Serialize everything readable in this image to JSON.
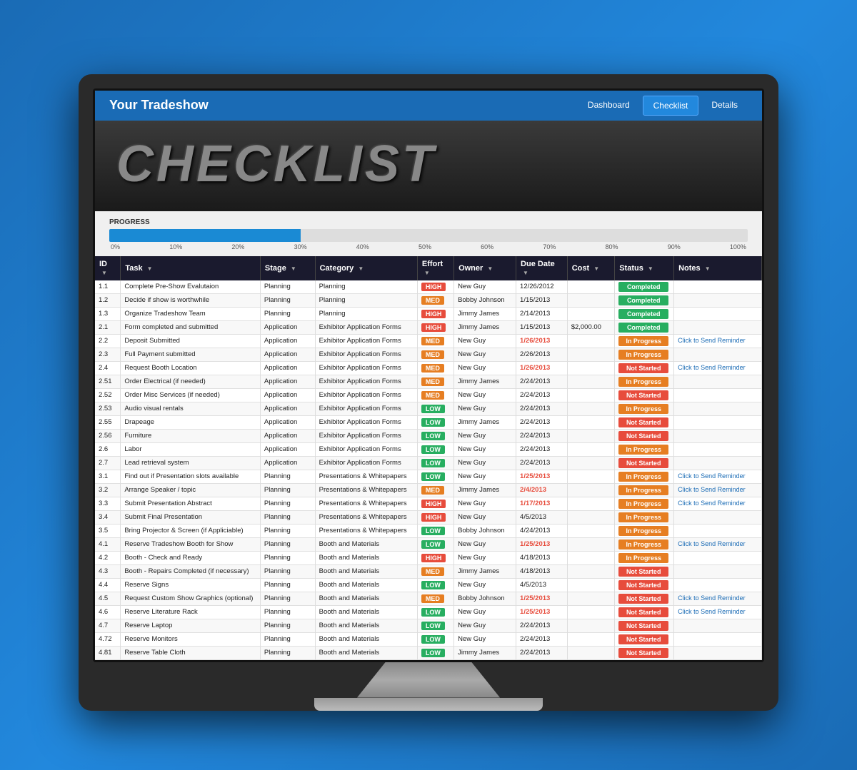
{
  "app": {
    "brand": "Your Tradeshow",
    "nav_links": [
      {
        "label": "Dashboard",
        "active": false
      },
      {
        "label": "Checklist",
        "active": true
      },
      {
        "label": "Details",
        "active": false
      }
    ]
  },
  "header": {
    "title": "CHECKLIST"
  },
  "progress": {
    "label": "PROGRESS",
    "percent": 30,
    "markers": [
      "0%",
      "10%",
      "20%",
      "30%",
      "40%",
      "50%",
      "60%",
      "70%",
      "80%",
      "90%",
      "100%"
    ]
  },
  "table": {
    "columns": [
      "ID",
      "Task",
      "Stage",
      "Category",
      "Effort",
      "Owner",
      "Due Date",
      "Cost",
      "Status",
      "Notes"
    ],
    "rows": [
      {
        "id": "1.1",
        "task": "Complete Pre-Show Evalutaion",
        "stage": "Planning",
        "category": "Planning",
        "effort": "HIGH",
        "owner": "New Guy",
        "date": "12/26/2012",
        "cost": "",
        "status": "Completed",
        "note": "",
        "date_red": false
      },
      {
        "id": "1.2",
        "task": "Decide if show is worthwhile",
        "stage": "Planning",
        "category": "Planning",
        "effort": "MED",
        "owner": "Bobby Johnson",
        "date": "1/15/2013",
        "cost": "",
        "status": "Completed",
        "note": "",
        "date_red": false
      },
      {
        "id": "1.3",
        "task": "Organize Tradeshow Team",
        "stage": "Planning",
        "category": "Planning",
        "effort": "HIGH",
        "owner": "Jimmy James",
        "date": "2/14/2013",
        "cost": "",
        "status": "Completed",
        "note": "",
        "date_red": false
      },
      {
        "id": "2.1",
        "task": "Form completed and submitted",
        "stage": "Application",
        "category": "Exhibitor Application Forms",
        "effort": "HIGH",
        "owner": "Jimmy James",
        "date": "1/15/2013",
        "cost": "$2,000.00",
        "status": "Completed",
        "note": "",
        "date_red": false
      },
      {
        "id": "2.2",
        "task": "Deposit Submitted",
        "stage": "Application",
        "category": "Exhibitor Application Forms",
        "effort": "MED",
        "owner": "New Guy",
        "date": "1/26/2013",
        "cost": "",
        "status": "In Progress",
        "note": "Click to Send Reminder",
        "date_red": true
      },
      {
        "id": "2.3",
        "task": "Full Payment submitted",
        "stage": "Application",
        "category": "Exhibitor Application Forms",
        "effort": "MED",
        "owner": "New Guy",
        "date": "2/26/2013",
        "cost": "",
        "status": "In Progress",
        "note": "",
        "date_red": false
      },
      {
        "id": "2.4",
        "task": "Request Booth Location",
        "stage": "Application",
        "category": "Exhibitor Application Forms",
        "effort": "MED",
        "owner": "New Guy",
        "date": "1/26/2013",
        "cost": "",
        "status": "Not Started",
        "note": "Click to Send Reminder",
        "date_red": true
      },
      {
        "id": "2.51",
        "task": "Order Electrical (if needed)",
        "stage": "Application",
        "category": "Exhibitor Application Forms",
        "effort": "MED",
        "owner": "Jimmy James",
        "date": "2/24/2013",
        "cost": "",
        "status": "In Progress",
        "note": "",
        "date_red": false
      },
      {
        "id": "2.52",
        "task": "Order Misc Services (if needed)",
        "stage": "Application",
        "category": "Exhibitor Application Forms",
        "effort": "MED",
        "owner": "New Guy",
        "date": "2/24/2013",
        "cost": "",
        "status": "Not Started",
        "note": "",
        "date_red": false
      },
      {
        "id": "2.53",
        "task": "Audio visual rentals",
        "stage": "Application",
        "category": "Exhibitor Application Forms",
        "effort": "LOW",
        "owner": "New Guy",
        "date": "2/24/2013",
        "cost": "",
        "status": "In Progress",
        "note": "",
        "date_red": false
      },
      {
        "id": "2.55",
        "task": "Drapeage",
        "stage": "Application",
        "category": "Exhibitor Application Forms",
        "effort": "LOW",
        "owner": "Jimmy James",
        "date": "2/24/2013",
        "cost": "",
        "status": "Not Started",
        "note": "",
        "date_red": false
      },
      {
        "id": "2.56",
        "task": "Furniture",
        "stage": "Application",
        "category": "Exhibitor Application Forms",
        "effort": "LOW",
        "owner": "New Guy",
        "date": "2/24/2013",
        "cost": "",
        "status": "Not Started",
        "note": "",
        "date_red": false
      },
      {
        "id": "2.6",
        "task": "Labor",
        "stage": "Application",
        "category": "Exhibitor Application Forms",
        "effort": "LOW",
        "owner": "New Guy",
        "date": "2/24/2013",
        "cost": "",
        "status": "In Progress",
        "note": "",
        "date_red": false
      },
      {
        "id": "2.7",
        "task": "Lead retrieval system",
        "stage": "Application",
        "category": "Exhibitor Application Forms",
        "effort": "LOW",
        "owner": "New Guy",
        "date": "2/24/2013",
        "cost": "",
        "status": "Not Started",
        "note": "",
        "date_red": false
      },
      {
        "id": "3.1",
        "task": "Find out if Presentation slots available",
        "stage": "Planning",
        "category": "Presentations & Whitepapers",
        "effort": "LOW",
        "owner": "New Guy",
        "date": "1/25/2013",
        "cost": "",
        "status": "In Progress",
        "note": "Click to Send Reminder",
        "date_red": true
      },
      {
        "id": "3.2",
        "task": "Arrange Speaker / topic",
        "stage": "Planning",
        "category": "Presentations & Whitepapers",
        "effort": "MED",
        "owner": "Jimmy James",
        "date": "2/4/2013",
        "cost": "",
        "status": "In Progress",
        "note": "Click to Send Reminder",
        "date_red": true
      },
      {
        "id": "3.3",
        "task": "Submit Presentation Abstract",
        "stage": "Planning",
        "category": "Presentations & Whitepapers",
        "effort": "HIGH",
        "owner": "New Guy",
        "date": "1/17/2013",
        "cost": "",
        "status": "In Progress",
        "note": "Click to Send Reminder",
        "date_red": true
      },
      {
        "id": "3.4",
        "task": "Submit Final Presentation",
        "stage": "Planning",
        "category": "Presentations & Whitepapers",
        "effort": "HIGH",
        "owner": "New Guy",
        "date": "4/5/2013",
        "cost": "",
        "status": "In Progress",
        "note": "",
        "date_red": false
      },
      {
        "id": "3.5",
        "task": "Bring Projector & Screen (if Appliciable)",
        "stage": "Planning",
        "category": "Presentations & Whitepapers",
        "effort": "LOW",
        "owner": "Bobby Johnson",
        "date": "4/24/2013",
        "cost": "",
        "status": "In Progress",
        "note": "",
        "date_red": false
      },
      {
        "id": "4.1",
        "task": "Reserve Tradeshow Booth for Show",
        "stage": "Planning",
        "category": "Booth and Materials",
        "effort": "LOW",
        "owner": "New Guy",
        "date": "1/25/2013",
        "cost": "",
        "status": "In Progress",
        "note": "Click to Send Reminder",
        "date_red": true
      },
      {
        "id": "4.2",
        "task": "Booth - Check and Ready",
        "stage": "Planning",
        "category": "Booth and Materials",
        "effort": "HIGH",
        "owner": "New Guy",
        "date": "4/18/2013",
        "cost": "",
        "status": "In Progress",
        "note": "",
        "date_red": false
      },
      {
        "id": "4.3",
        "task": "Booth - Repairs Completed (if necessary)",
        "stage": "Planning",
        "category": "Booth and Materials",
        "effort": "MED",
        "owner": "Jimmy James",
        "date": "4/18/2013",
        "cost": "",
        "status": "Not Started",
        "note": "",
        "date_red": false
      },
      {
        "id": "4.4",
        "task": "Reserve Signs",
        "stage": "Planning",
        "category": "Booth and Materials",
        "effort": "LOW",
        "owner": "New Guy",
        "date": "4/5/2013",
        "cost": "",
        "status": "Not Started",
        "note": "",
        "date_red": false
      },
      {
        "id": "4.5",
        "task": "Request Custom Show Graphics (optional)",
        "stage": "Planning",
        "category": "Booth and Materials",
        "effort": "MED",
        "owner": "Bobby Johnson",
        "date": "1/25/2013",
        "cost": "",
        "status": "Not Started",
        "note": "Click to Send Reminder",
        "date_red": true
      },
      {
        "id": "4.6",
        "task": "Reserve Literature Rack",
        "stage": "Planning",
        "category": "Booth and Materials",
        "effort": "LOW",
        "owner": "New Guy",
        "date": "1/25/2013",
        "cost": "",
        "status": "Not Started",
        "note": "Click to Send Reminder",
        "date_red": true
      },
      {
        "id": "4.7",
        "task": "Reserve Laptop",
        "stage": "Planning",
        "category": "Booth and Materials",
        "effort": "LOW",
        "owner": "New Guy",
        "date": "2/24/2013",
        "cost": "",
        "status": "Not Started",
        "note": "",
        "date_red": false
      },
      {
        "id": "4.72",
        "task": "Reserve Monitors",
        "stage": "Planning",
        "category": "Booth and Materials",
        "effort": "LOW",
        "owner": "New Guy",
        "date": "2/24/2013",
        "cost": "",
        "status": "Not Started",
        "note": "",
        "date_red": false
      },
      {
        "id": "4.81",
        "task": "Reserve Table Cloth",
        "stage": "Planning",
        "category": "Booth and Materials",
        "effort": "LOW",
        "owner": "Jimmy James",
        "date": "2/24/2013",
        "cost": "",
        "status": "Not Started",
        "note": "",
        "date_red": false
      }
    ]
  }
}
